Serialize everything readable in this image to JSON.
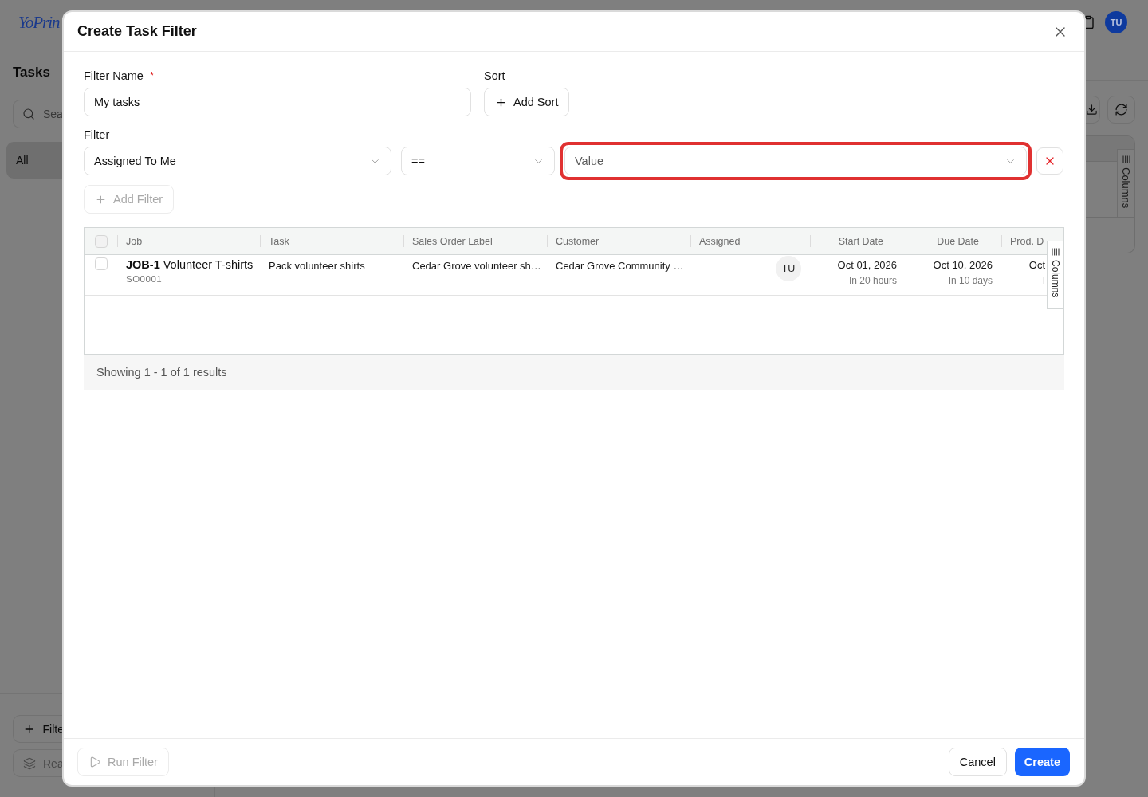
{
  "background_page": {
    "header": {
      "logo": "YoPrin",
      "avatar": "TU"
    },
    "sidebar": {
      "title": "Tasks",
      "search": {
        "placeholder": "Sea"
      },
      "items": [
        {
          "label": "All",
          "selected": true
        }
      ],
      "buttons": [
        {
          "kind": "add",
          "label": "Filte",
          "disabled": false
        },
        {
          "kind": "layers",
          "label": "Rea",
          "disabled": true
        }
      ]
    },
    "table": {
      "columns_tab": "Columns"
    }
  },
  "dialog": {
    "title": "Create Task Filter",
    "filter_name": {
      "label": "Filter Name",
      "required_mark": "*",
      "value": "My tasks"
    },
    "sort": {
      "label": "Sort",
      "add_button": "Add Sort"
    },
    "filter": {
      "label": "Filter",
      "rows": [
        {
          "field": "Assigned To Me",
          "operator": "==",
          "value": {
            "placeholder": "Value"
          },
          "highlighted": true
        }
      ],
      "add_button": {
        "label": "Add Filter",
        "disabled": true
      }
    },
    "table": {
      "select_all": {
        "checked": false
      },
      "columns": [
        "Job",
        "Task",
        "Sales Order Label",
        "Customer",
        "Assigned",
        "Start Date",
        "Due Date",
        "Prod. D"
      ],
      "rows": [
        {
          "selected": false,
          "job": {
            "title": "**JOB-1** Volunteer T-shirts",
            "sales_order": "SO0001"
          },
          "task": "Pack volunteer shirts",
          "sales_order_label": "Cedar Grove volunteer sh…",
          "customer": "Cedar Grove Community …",
          "assigned": "TU",
          "start_date": {
            "date": "Oct 01, 2026",
            "relative": "In 20 hours"
          },
          "due_date": {
            "date": "Oct 10, 2026",
            "relative": "In 10 days"
          },
          "column_9": {
            "date": "Oct",
            "relative": "I"
          }
        }
      ],
      "columns_tab": "Columns"
    },
    "results_summary": "Showing 1 - 1 of 1 results",
    "footer": {
      "run_button": {
        "label": "Run Filter",
        "disabled": true
      },
      "cancel_button": "Cancel",
      "create_button": "Create"
    }
  }
}
